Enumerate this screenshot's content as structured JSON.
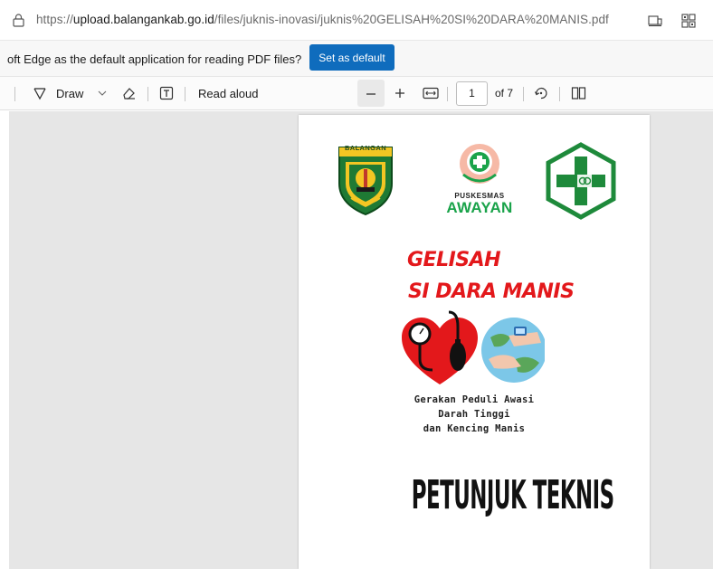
{
  "address_bar": {
    "url_prefix": "https://",
    "url_host": "upload.balangankab.go.id",
    "url_path": "/files/juknis-inovasi/juknis%20GELISAH%20SI%20DARA%20MANIS.pdf"
  },
  "notification": {
    "text": "oft Edge as the default application for reading PDF files?",
    "button_label": "Set as default"
  },
  "toolbar": {
    "draw_label": "Draw",
    "read_aloud_label": "Read aloud",
    "page_number": "1",
    "page_total": "of 7"
  },
  "document": {
    "balangan_label": "BALANGAN",
    "puskesmas_label": "PUSKESMAS",
    "puskesmas_name": "AWAYAN",
    "title_line1": "GELISAH",
    "title_line2": "SI DARA MANIS",
    "caption_lines": [
      "Gerakan Peduli Awasi",
      "Darah Tinggi",
      "dan Kencing Manis"
    ],
    "headline": "PETUNJUK TEKNIS"
  },
  "colors": {
    "accent_button": "#0f6cbd",
    "title_red": "#e3181b",
    "puskesmas_green": "#1aa34a",
    "cross_green": "#1e8a3b"
  },
  "icons": {
    "lock": "lock-icon",
    "read_mode": "read-mode-icon",
    "extensions": "apps-icon",
    "draw": "draw-icon",
    "draw_dropdown": "chevron-down-icon",
    "erase": "eraser-icon",
    "text": "text-box-icon",
    "zoom_out": "minus-icon",
    "zoom_in": "plus-icon",
    "fit": "fit-width-icon",
    "rotate": "rotate-icon",
    "page_view": "page-view-icon"
  }
}
